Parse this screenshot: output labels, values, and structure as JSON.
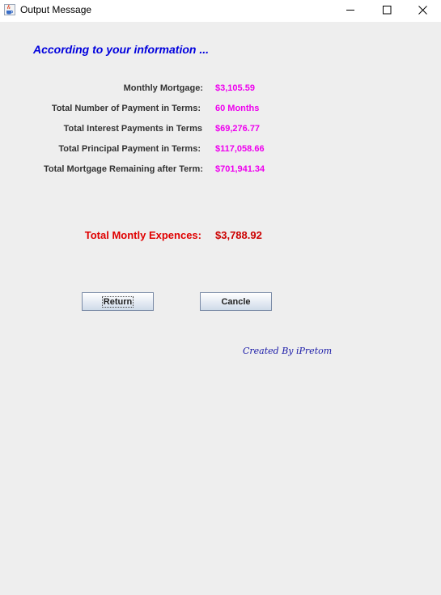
{
  "window": {
    "title": "Output Message",
    "icon": "java-cup-icon"
  },
  "heading": "According to your information ...",
  "rows": [
    {
      "label": "Monthly Mortgage:",
      "value": "$3,105.59"
    },
    {
      "label": "Total Number of Payment in Terms:",
      "value": "60 Months"
    },
    {
      "label": "Total Interest Payments in Terms",
      "value": "$69,276.77"
    },
    {
      "label": "Total Principal Payment in Terms:",
      "value": "$117,058.66"
    },
    {
      "label": "Total Mortgage Remaining after Term:",
      "value": "$701,941.34"
    }
  ],
  "total": {
    "label": "Total Montly Expences:",
    "value": "$3,788.92"
  },
  "buttons": {
    "return_label": "Return",
    "cancel_label": "Cancle"
  },
  "credit": "Created By iPretom",
  "colors": {
    "heading": "#0000dd",
    "value": "#ee00ee",
    "total_label": "#e00000",
    "total_value": "#cc0000"
  }
}
